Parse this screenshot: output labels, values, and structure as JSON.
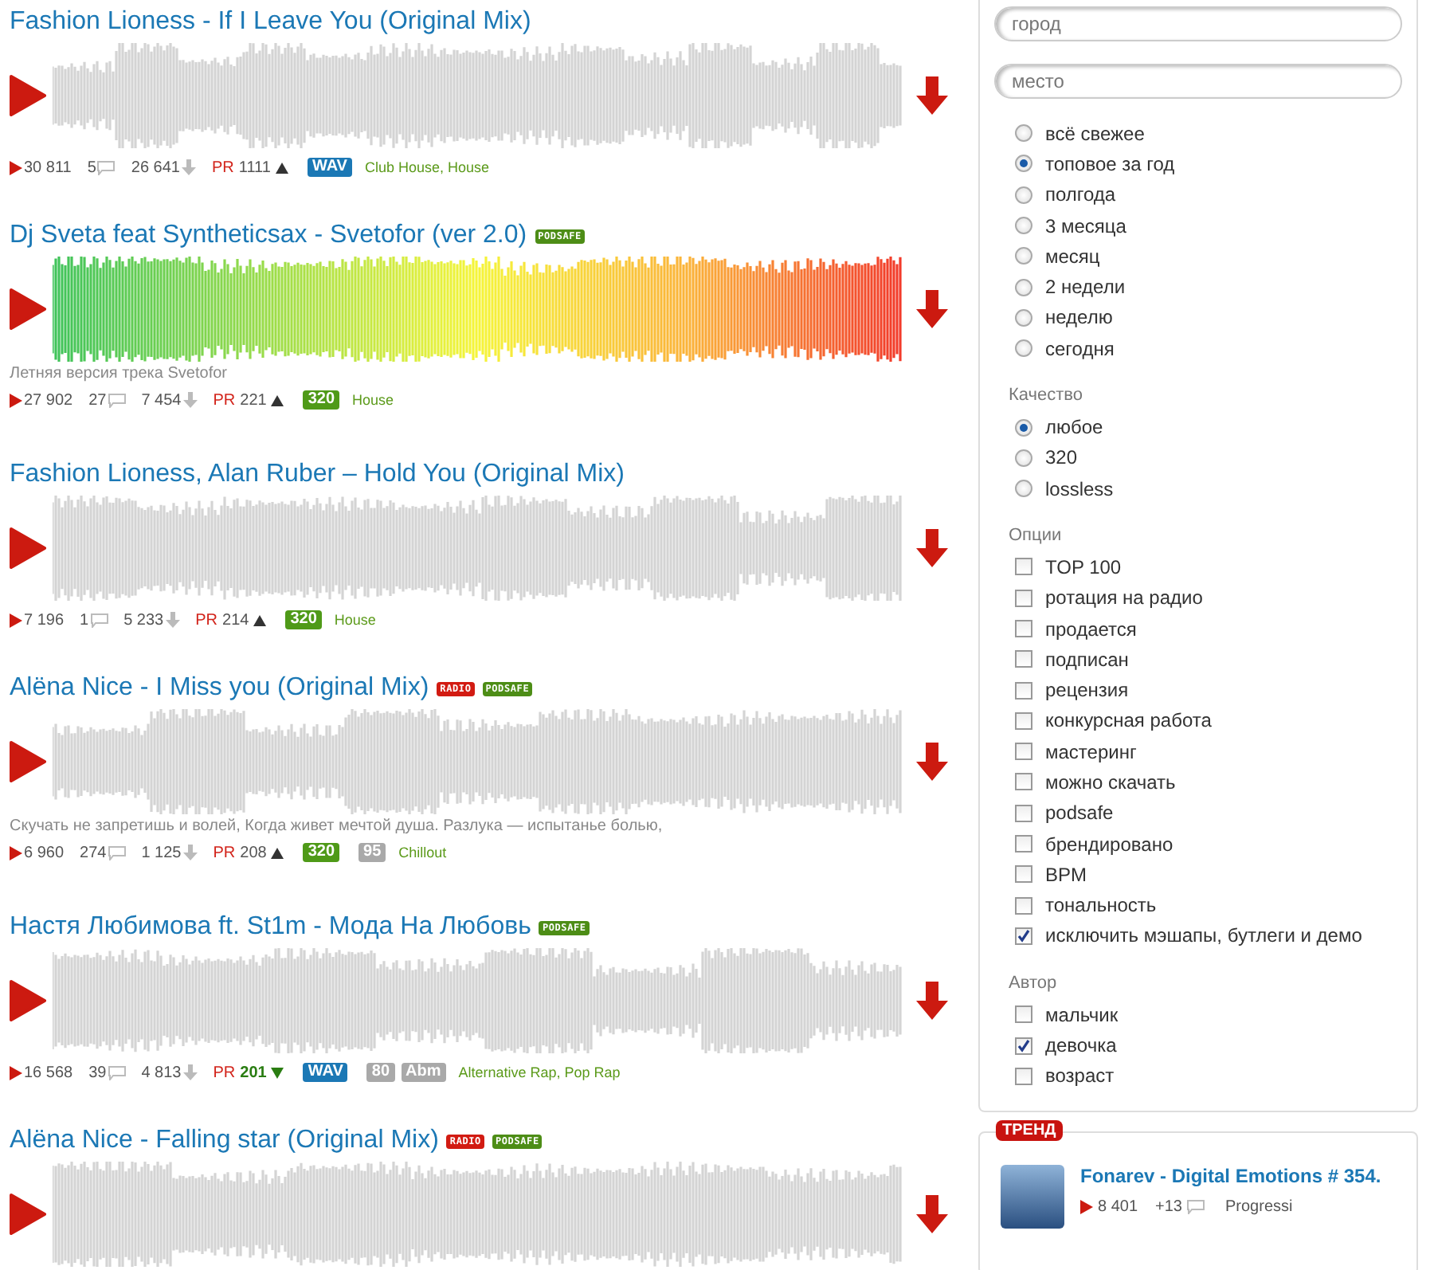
{
  "tracks": [
    {
      "title": "Fashion Lioness - If I Leave You (Original Mix)",
      "colored": false,
      "plays": "30 811",
      "comments": "5",
      "downloads": "26 641",
      "pr_label": "PR",
      "pr": "1111",
      "pr_falling": false,
      "formats": [
        {
          "text": "WAV",
          "kind": "wav"
        }
      ],
      "genres": "Club House, House"
    },
    {
      "title": "Dj Sveta feat Syntheticsax - Svetofor (ver 2.0)",
      "labels": [
        {
          "text": "PODSAFE",
          "kind": "podsafe"
        }
      ],
      "colored": true,
      "description": "Летняя версия трека Svetofor",
      "plays": "27 902",
      "comments": "27",
      "downloads": "7 454",
      "pr_label": "PR",
      "pr": "221",
      "pr_falling": false,
      "formats": [
        {
          "text": "320",
          "kind": "bitrate"
        }
      ],
      "genres": "House"
    },
    {
      "title": "Fashion Lioness, Alan Ruber – Hold You (Original Mix)",
      "colored": false,
      "plays": "7 196",
      "comments": "1",
      "downloads": "5 233",
      "pr_label": "PR",
      "pr": "214",
      "pr_falling": false,
      "formats": [
        {
          "text": "320",
          "kind": "bitrate"
        }
      ],
      "genres": "House"
    },
    {
      "title": "Alёna Nice - I Miss you (Original Mix)",
      "labels": [
        {
          "text": "RADIO",
          "kind": "radio"
        },
        {
          "text": "PODSAFE",
          "kind": "podsafe"
        }
      ],
      "colored": false,
      "description": "Скучать не запретишь и волей, Когда живет мечтой душа. Разлука — испытанье болью,",
      "plays": "6 960",
      "comments": "274",
      "downloads": "1 125",
      "pr_label": "PR",
      "pr": "208",
      "pr_falling": false,
      "formats": [
        {
          "text": "320",
          "kind": "bitrate"
        },
        {
          "text": "95",
          "kind": "meta"
        }
      ],
      "genres": "Chillout"
    },
    {
      "title": "Настя Любимова ft. St1m - Мода На Любовь",
      "labels": [
        {
          "text": "PODSAFE",
          "kind": "podsafe"
        }
      ],
      "colored": false,
      "plays": "16 568",
      "comments": "39",
      "downloads": "4 813",
      "pr_label": "PR",
      "pr": "201",
      "pr_falling": true,
      "formats": [
        {
          "text": "WAV",
          "kind": "wav"
        },
        {
          "text": "80",
          "kind": "meta"
        },
        {
          "text": "Abm",
          "kind": "meta"
        }
      ],
      "genres": "Alternative Rap, Pop Rap"
    },
    {
      "title": "Alёna Nice - Falling star (Original Mix)",
      "labels": [
        {
          "text": "RADIO",
          "kind": "radio"
        },
        {
          "text": "PODSAFE",
          "kind": "podsafe"
        }
      ],
      "colored": false
    }
  ],
  "filters": {
    "city": {
      "placeholder": "город"
    },
    "place": {
      "placeholder": "место"
    },
    "period": [
      {
        "label": "всё свежее",
        "selected": false
      },
      {
        "label": "топовое за год",
        "selected": true
      },
      {
        "label": "полгода",
        "selected": false
      },
      {
        "label": "3 месяца",
        "selected": false
      },
      {
        "label": "месяц",
        "selected": false
      },
      {
        "label": "2 недели",
        "selected": false
      },
      {
        "label": "неделю",
        "selected": false
      },
      {
        "label": "сегодня",
        "selected": false
      }
    ],
    "quality": {
      "title": "Качество",
      "options": [
        {
          "label": "любое",
          "selected": true
        },
        {
          "label": "320",
          "selected": false
        },
        {
          "label": "lossless",
          "selected": false
        }
      ]
    },
    "options": {
      "title": "Опции",
      "items": [
        {
          "label": "TOP 100",
          "checked": false
        },
        {
          "label": "ротация на радио",
          "checked": false
        },
        {
          "label": "продается",
          "checked": false
        },
        {
          "label": "подписан",
          "checked": false
        },
        {
          "label": "рецензия",
          "checked": false
        },
        {
          "label": "конкурсная работа",
          "checked": false
        },
        {
          "label": "мастеринг",
          "checked": false
        },
        {
          "label": "можно скачать",
          "checked": false
        },
        {
          "label": "podsafe",
          "checked": false
        },
        {
          "label": "брендировано",
          "checked": false
        },
        {
          "label": "BPM",
          "checked": false
        },
        {
          "label": "тональность",
          "checked": false
        },
        {
          "label": "исключить мэшапы, бутлеги и демо",
          "checked": true
        }
      ]
    },
    "author": {
      "title": "Автор",
      "items": [
        {
          "label": "мальчик",
          "checked": false
        },
        {
          "label": "девочка",
          "checked": true
        },
        {
          "label": "возраст",
          "checked": false
        }
      ]
    }
  },
  "trend": {
    "badge": "ТРЕНД",
    "title": "Fonarev - Digital Emotions # 354.",
    "plays": "8 401",
    "comments": "+13",
    "genre": "Progressi"
  }
}
